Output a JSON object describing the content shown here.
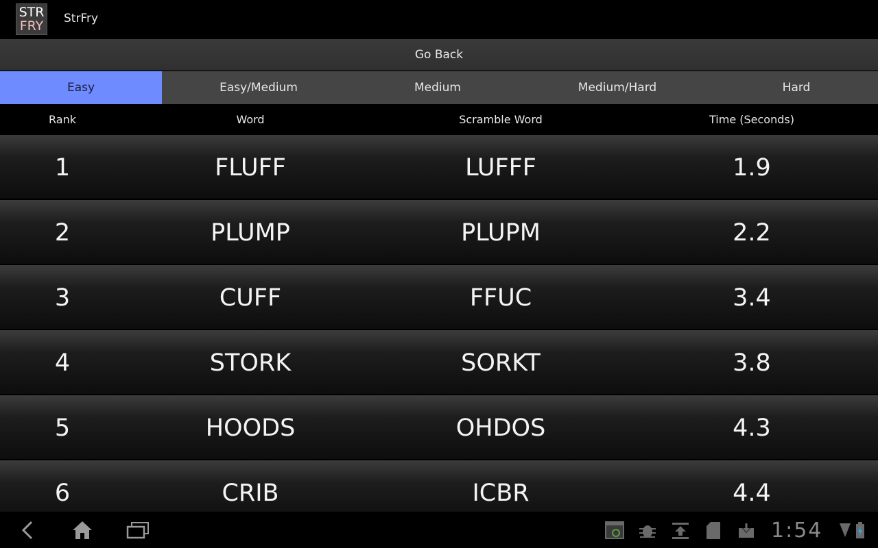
{
  "app": {
    "logo_line1": "STR",
    "logo_line2": "FRY",
    "title": "StrFry"
  },
  "go_back_label": "Go Back",
  "tabs": [
    {
      "label": "Easy",
      "active": true
    },
    {
      "label": "Easy/Medium",
      "active": false
    },
    {
      "label": "Medium",
      "active": false
    },
    {
      "label": "Medium/Hard",
      "active": false
    },
    {
      "label": "Hard",
      "active": false
    }
  ],
  "columns": {
    "rank": "Rank",
    "word": "Word",
    "scramble": "Scramble Word",
    "time": "Time (Seconds)"
  },
  "rows": [
    {
      "rank": "1",
      "word": "FLUFF",
      "scramble": "LUFFF",
      "time": "1.9"
    },
    {
      "rank": "2",
      "word": "PLUMP",
      "scramble": "PLUPM",
      "time": "2.2"
    },
    {
      "rank": "3",
      "word": "CUFF",
      "scramble": "FFUC",
      "time": "3.4"
    },
    {
      "rank": "4",
      "word": "STORK",
      "scramble": "SORKT",
      "time": "3.8"
    },
    {
      "rank": "5",
      "word": "HOODS",
      "scramble": "OHDOS",
      "time": "4.3"
    },
    {
      "rank": "6",
      "word": "CRIB",
      "scramble": "ICBR",
      "time": "4.4"
    }
  ],
  "status_bar": {
    "clock": "1:54",
    "icons": [
      "screenshot-icon",
      "debug-icon",
      "upload-icon",
      "sd-card-icon",
      "download-icon",
      "wifi-icon",
      "battery-icon"
    ]
  },
  "nav": {
    "icons": [
      "back-icon",
      "home-icon",
      "recent-apps-icon"
    ]
  },
  "colors": {
    "active_tab": "#6e8cff",
    "tab_bg": "#454545"
  }
}
